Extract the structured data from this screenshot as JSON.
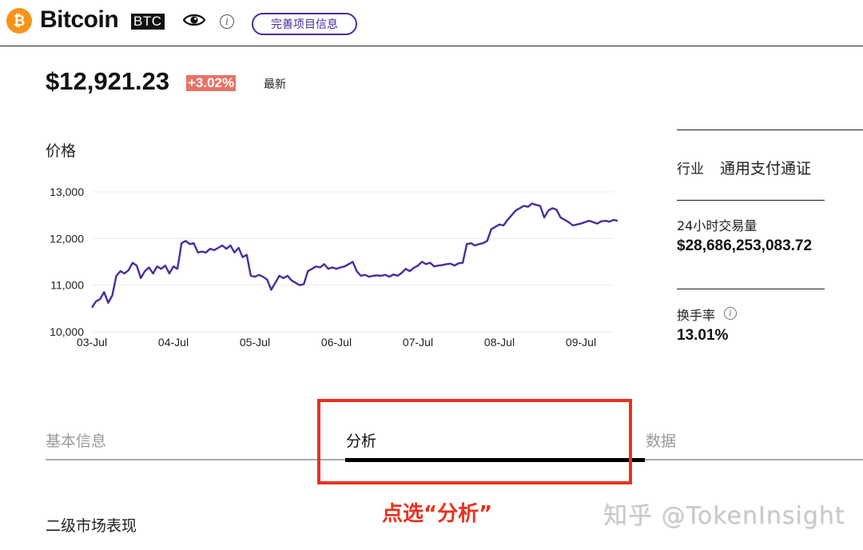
{
  "header": {
    "logo_glyph": "₿",
    "coin_name": "Bitcoin",
    "coin_symbol": "BTC",
    "info_glyph": "i",
    "complete_info_button": "完善项目信息"
  },
  "price": {
    "value": "$12,921.23",
    "change": "+3.02%",
    "latest_label": "最新"
  },
  "chart_title": "价格",
  "chart_data": {
    "type": "line",
    "y_ticks": [
      10000,
      11000,
      12000,
      13000
    ],
    "y_tick_labels": [
      "10,000",
      "11,000",
      "12,000",
      "13,000"
    ],
    "ylim": [
      10000,
      13000
    ],
    "x_tick_labels": [
      "03-Jul",
      "04-Jul",
      "05-Jul",
      "06-Jul",
      "07-Jul",
      "08-Jul",
      "09-Jul"
    ],
    "xlim": [
      0,
      6.45
    ],
    "grid": true,
    "line_color": "#4a2ca0",
    "series": [
      {
        "x": [
          0,
          0.05,
          0.1,
          0.15,
          0.2,
          0.25,
          0.3,
          0.35,
          0.4,
          0.45,
          0.5,
          0.55,
          0.6,
          0.65,
          0.7,
          0.75,
          0.8,
          0.85,
          0.9,
          0.95,
          1.0,
          1.05,
          1.1,
          1.15,
          1.2,
          1.25,
          1.3,
          1.35,
          1.4,
          1.45,
          1.5,
          1.55,
          1.6,
          1.65,
          1.7,
          1.75,
          1.8,
          1.85,
          1.9,
          1.95,
          2.0,
          2.05,
          2.1,
          2.15,
          2.2,
          2.25,
          2.3,
          2.35,
          2.4,
          2.45,
          2.5,
          2.55,
          2.6,
          2.65,
          2.7,
          2.75,
          2.8,
          2.85,
          2.9,
          2.95,
          3.0,
          3.05,
          3.1,
          3.15,
          3.2,
          3.25,
          3.3,
          3.35,
          3.4,
          3.45,
          3.5,
          3.55,
          3.6,
          3.65,
          3.7,
          3.75,
          3.8,
          3.85,
          3.9,
          3.95,
          4.0,
          4.05,
          4.1,
          4.15,
          4.2,
          4.25,
          4.3,
          4.35,
          4.4,
          4.45,
          4.5,
          4.55,
          4.6,
          4.65,
          4.7,
          4.75,
          4.8,
          4.85,
          4.9,
          4.95,
          5.0,
          5.05,
          5.1,
          5.15,
          5.2,
          5.25,
          5.3,
          5.35,
          5.4,
          5.45,
          5.5,
          5.55,
          5.6,
          5.65,
          5.7,
          5.75,
          5.8,
          5.85,
          5.9,
          5.95,
          6.0,
          6.05,
          6.1,
          6.15,
          6.2,
          6.25,
          6.3,
          6.35,
          6.4,
          6.45
        ],
        "values": [
          10520,
          10650,
          10700,
          10850,
          10620,
          10780,
          11200,
          11300,
          11250,
          11320,
          11480,
          11420,
          11150,
          11300,
          11380,
          11250,
          11400,
          11350,
          11420,
          11250,
          11400,
          11350,
          11900,
          11950,
          11880,
          11900,
          11700,
          11720,
          11700,
          11780,
          11750,
          11800,
          11850,
          11780,
          11850,
          11700,
          11800,
          11600,
          11650,
          11200,
          11180,
          11220,
          11180,
          11120,
          10900,
          11050,
          11200,
          11150,
          11200,
          11100,
          11050,
          11000,
          11020,
          11300,
          11350,
          11400,
          11380,
          11450,
          11350,
          11380,
          11350,
          11380,
          11400,
          11450,
          11500,
          11300,
          11200,
          11220,
          11180,
          11200,
          11210,
          11200,
          11220,
          11180,
          11230,
          11200,
          11260,
          11350,
          11300,
          11370,
          11420,
          11500,
          11450,
          11480,
          11400,
          11420,
          11430,
          11450,
          11460,
          11420,
          11470,
          11480,
          11880,
          11900,
          11850,
          11880,
          11900,
          11950,
          12200,
          12250,
          12300,
          12280,
          12400,
          12500,
          12600,
          12650,
          12700,
          12680,
          12750,
          12720,
          12700,
          12450,
          12600,
          12650,
          12620,
          12450,
          12400,
          12350,
          12280,
          12300,
          12320,
          12350,
          12380,
          12350,
          12320,
          12370,
          12380,
          12360,
          12400,
          12380
        ]
      }
    ]
  },
  "stats": {
    "industry_label": "行业",
    "industry_value": "通用支付通证",
    "volume_label": "24小时交易量",
    "volume_value": "$28,686,253,083.72",
    "turnover_label": "换手率",
    "turnover_info_glyph": "i",
    "turnover_value": "13.01%"
  },
  "tabs": [
    {
      "label": "基本信息",
      "active": false
    },
    {
      "label": "分析",
      "active": true
    },
    {
      "label": "数据",
      "active": false
    }
  ],
  "annotation": {
    "text": "点选“分析”",
    "color": "#e8321f"
  },
  "watermark": "知乎 @TokenInsight",
  "section_title": "二级市场表现"
}
